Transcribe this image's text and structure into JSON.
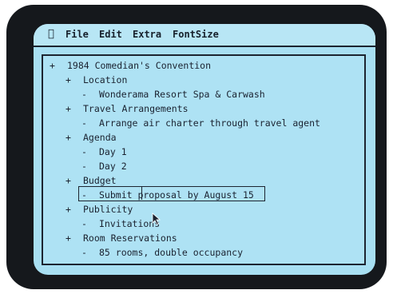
{
  "menubar": {
    "apple_icon": "apple-icon",
    "items": [
      {
        "label": "File"
      },
      {
        "label": "Edit"
      },
      {
        "label": "Extra"
      },
      {
        "label": "FontSize"
      }
    ]
  },
  "outline": {
    "rows": [
      {
        "marker": "+",
        "text": "1984 Comedian's Convention"
      },
      {
        "marker": "+",
        "text": "Location"
      },
      {
        "marker": "-",
        "text": "Wonderama Resort Spa & Carwash"
      },
      {
        "marker": "+",
        "text": "Travel Arrangements"
      },
      {
        "marker": "-",
        "text": "Arrange air charter through travel agent"
      },
      {
        "marker": "+",
        "text": "Agenda"
      },
      {
        "marker": "-",
        "text": "Day 1"
      },
      {
        "marker": "-",
        "text": "Day 2"
      },
      {
        "marker": "+",
        "text": "Budget"
      },
      {
        "marker": "-",
        "text": "Submit proposal by August 15"
      },
      {
        "marker": "+",
        "text": "Publicity"
      },
      {
        "marker": "-",
        "text": "Invitations"
      },
      {
        "marker": "+",
        "text": "Room Reservations"
      },
      {
        "marker": "-",
        "text": "85 rooms, double occupancy"
      }
    ]
  },
  "colors": {
    "screen": "#a8dff2",
    "text": "#1a2230",
    "bezel": "#15181c"
  }
}
